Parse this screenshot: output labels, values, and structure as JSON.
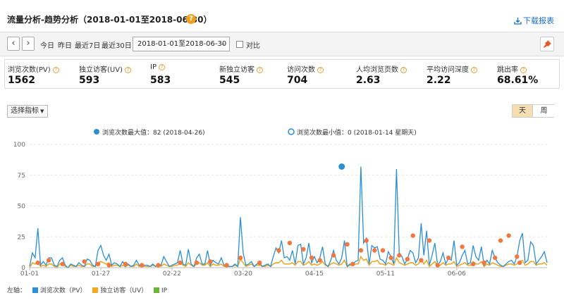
{
  "header": {
    "title": "流量分析-趋势分析（2018-01-01至2018-06-30）",
    "help_icon": "?",
    "download_label": "下载报表"
  },
  "toolbar": {
    "prev_icon": "‹",
    "next_icon": "›",
    "quick_ranges": [
      "今日",
      "昨日",
      "最近7日",
      "最近30日"
    ],
    "date_range_value": "2018-01-01至2018-06-30",
    "compare_label": "对比"
  },
  "metrics": [
    {
      "label": "浏览次数(PV)",
      "value": "1562"
    },
    {
      "label": "独立访客(UV)",
      "value": "593"
    },
    {
      "label": "IP",
      "value": "583"
    },
    {
      "label": "新独立访客",
      "value": "545"
    },
    {
      "label": "访问次数",
      "value": "704"
    },
    {
      "label": "人均浏览页数",
      "value": "2.63"
    },
    {
      "label": "平均访问深度",
      "value": "2.22"
    },
    {
      "label": "跳出率",
      "value": "68.61%"
    }
  ],
  "controls": {
    "select_metric_label": "选择指标",
    "period_day": "天",
    "period_week": "周"
  },
  "chart_data": {
    "type": "line",
    "annotations": {
      "max_label": "浏览次数最大值：82 (2018-04-26)",
      "min_label": "浏览次数最小值：0 (2018-01-14 星期天)"
    },
    "y_ticks": [
      "100",
      "75",
      "50",
      "25",
      "0"
    ],
    "ylim": [
      0,
      100
    ],
    "x_tick_labels": [
      "01-01",
      "01-27",
      "02-22",
      "03-20",
      "04-15",
      "05-11",
      "06-06"
    ],
    "x_tick_indices": [
      0,
      26,
      52,
      78,
      104,
      130,
      156
    ],
    "grid": true,
    "series": [
      {
        "name": "浏览次数（PV）",
        "color": "#2b8fd6",
        "values": [
          1,
          12,
          8,
          32,
          2,
          5,
          2,
          8,
          8,
          2,
          1,
          6,
          8,
          2,
          0,
          3,
          2,
          1,
          4,
          2,
          1,
          7,
          6,
          2,
          1,
          14,
          18,
          10,
          6,
          11,
          2,
          4,
          3,
          1,
          5,
          1,
          3,
          1,
          2,
          6,
          2,
          1,
          2,
          2,
          1,
          3,
          1,
          3,
          2,
          9,
          5,
          1,
          2,
          3,
          4,
          14,
          3,
          2,
          15,
          3,
          1,
          8,
          11,
          3,
          3,
          14,
          2,
          6,
          4,
          3,
          8,
          2,
          2,
          1,
          1,
          3,
          1,
          41,
          12,
          2,
          3,
          5,
          1,
          3,
          4,
          1,
          2,
          3,
          1,
          9,
          16,
          12,
          22,
          8,
          9,
          6,
          14,
          3,
          18,
          19,
          3,
          8,
          20,
          4,
          9,
          4,
          8,
          17,
          3,
          1,
          6,
          14,
          6,
          3,
          8,
          22,
          1,
          3,
          3,
          5,
          6,
          82,
          20,
          24,
          3,
          18,
          16,
          17,
          7,
          6,
          3,
          13,
          9,
          3,
          80,
          12,
          9,
          3,
          7,
          14,
          12,
          4,
          8,
          36,
          10,
          30,
          2,
          10,
          20,
          2,
          5,
          12,
          3,
          8,
          6,
          22,
          2,
          4,
          10,
          14,
          3,
          4,
          18,
          9,
          6,
          17,
          2,
          6,
          3,
          14,
          8,
          4,
          2,
          1,
          3,
          5,
          6,
          3,
          9,
          22,
          28,
          4,
          6,
          21,
          18,
          3,
          6,
          9,
          13,
          4
        ],
        "chart_points_note": ""
      },
      {
        "name": "独立访客（UV）",
        "color": "#f5a623",
        "values": [
          0,
          4,
          3,
          4,
          1,
          2,
          1,
          3,
          3,
          1,
          0,
          3,
          3,
          1,
          0,
          2,
          1,
          1,
          2,
          1,
          1,
          3,
          3,
          1,
          1,
          4,
          5,
          4,
          3,
          4,
          1,
          2,
          2,
          1,
          2,
          1,
          2,
          1,
          1,
          3,
          1,
          1,
          1,
          1,
          1,
          2,
          1,
          2,
          1,
          3,
          2,
          1,
          1,
          2,
          2,
          4,
          2,
          1,
          4,
          2,
          1,
          3,
          4,
          2,
          2,
          4,
          1,
          3,
          2,
          2,
          3,
          1,
          1,
          1,
          1,
          2,
          1,
          7,
          4,
          1,
          2,
          3,
          1,
          2,
          2,
          1,
          1,
          2,
          1,
          3,
          4,
          4,
          6,
          3,
          3,
          3,
          4,
          2,
          5,
          5,
          2,
          3,
          5,
          2,
          3,
          2,
          3,
          5,
          2,
          1,
          3,
          4,
          3,
          2,
          3,
          6,
          1,
          2,
          2,
          3,
          3,
          9,
          6,
          7,
          2,
          5,
          5,
          6,
          3,
          3,
          2,
          4,
          3,
          2,
          8,
          4,
          3,
          2,
          3,
          4,
          4,
          2,
          3,
          7,
          3,
          6,
          1,
          3,
          5,
          1,
          2,
          4,
          2,
          3,
          3,
          5,
          1,
          2,
          3,
          4,
          2,
          2,
          5,
          3,
          3,
          5,
          1,
          3,
          2,
          4,
          3,
          2,
          1,
          1,
          2,
          3,
          3,
          2,
          3,
          5,
          6,
          2,
          3,
          5,
          5,
          2,
          3,
          3,
          4,
          2
        ]
      },
      {
        "name": "IP",
        "color": "#6ab536",
        "values": [
          0,
          4,
          3,
          4,
          1,
          2,
          1,
          3,
          3,
          1,
          0,
          3,
          3,
          1,
          0,
          2,
          1,
          1,
          2,
          1,
          1,
          3,
          3,
          1,
          1,
          4,
          5,
          4,
          3,
          4,
          1,
          2,
          2,
          1,
          2,
          1,
          2,
          1,
          1,
          3,
          1,
          1,
          1,
          1,
          1,
          2,
          1,
          2,
          1,
          3,
          2,
          1,
          1,
          2,
          2,
          4,
          2,
          1,
          4,
          2,
          1,
          3,
          4,
          2,
          2,
          4,
          1,
          3,
          2,
          2,
          3,
          1,
          1,
          1,
          1,
          2,
          1,
          7,
          4,
          1,
          2,
          3,
          1,
          2,
          2,
          1,
          1,
          2,
          1,
          3,
          4,
          4,
          6,
          3,
          3,
          3,
          4,
          2,
          5,
          5,
          2,
          3,
          5,
          2,
          3,
          2,
          3,
          5,
          2,
          1,
          3,
          4,
          3,
          2,
          3,
          6,
          1,
          2,
          2,
          3,
          3,
          9,
          6,
          7,
          2,
          5,
          5,
          6,
          3,
          3,
          2,
          4,
          3,
          2,
          8,
          4,
          3,
          2,
          3,
          4,
          4,
          2,
          3,
          7,
          3,
          6,
          1,
          3,
          5,
          1,
          2,
          4,
          2,
          3,
          3,
          5,
          1,
          2,
          3,
          4,
          2,
          2,
          5,
          3,
          3,
          5,
          1,
          3,
          2,
          4,
          3,
          2,
          1,
          1,
          2,
          3,
          3,
          2,
          3,
          5,
          6,
          2,
          3,
          5,
          5,
          2,
          3,
          3,
          4,
          2
        ]
      }
    ],
    "highlight_markers": {
      "color": "#f07840",
      "indices": [
        3,
        7,
        12,
        20,
        25,
        29,
        35,
        41,
        47,
        55,
        61,
        66,
        72,
        77,
        84,
        91,
        95,
        100,
        103,
        106,
        111,
        116,
        118,
        121,
        123,
        126,
        129,
        132,
        135,
        138,
        140,
        143,
        146,
        149,
        153,
        158,
        162,
        166,
        170,
        172,
        175,
        178,
        179
      ],
      "values": [
        4,
        6,
        3,
        5,
        3,
        2,
        3,
        2,
        2,
        4,
        4,
        5,
        2,
        8,
        4,
        14,
        20,
        15,
        8,
        6,
        10,
        19,
        3,
        14,
        22,
        14,
        14,
        8,
        10,
        7,
        26,
        6,
        22,
        2,
        8,
        17,
        3,
        4,
        8,
        22,
        26,
        9,
        4
      ]
    },
    "max_point": {
      "index": 114,
      "value": 82
    },
    "legend_prefix": "左轴："
  }
}
